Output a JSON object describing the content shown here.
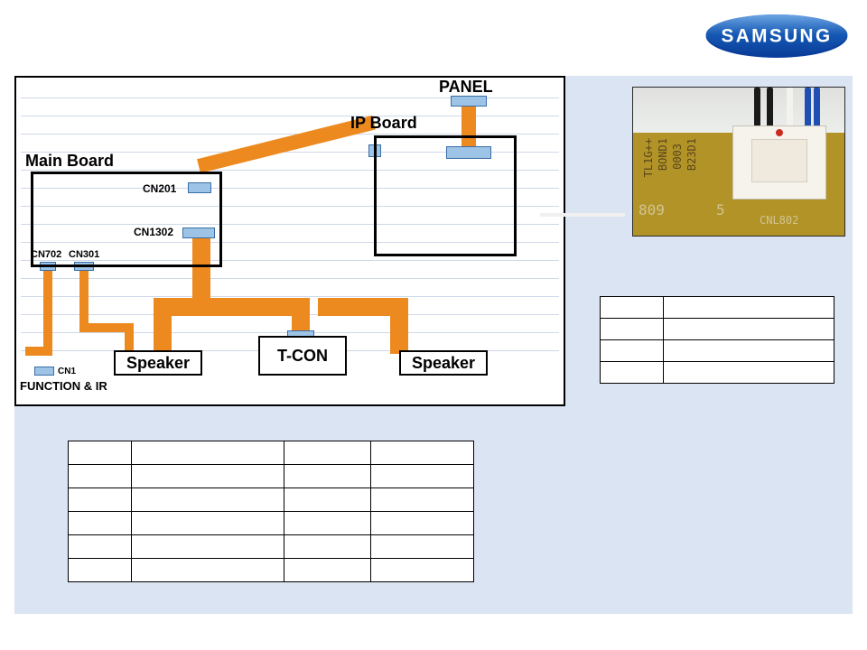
{
  "brand": "SAMSUNG",
  "diagram": {
    "labels": {
      "panel": "PANEL",
      "ip_board": "IP Board",
      "main_board": "Main Board",
      "cn201": "CN201",
      "cn1302": "CN1302",
      "cn702": "CN702",
      "cn301": "CN301",
      "cn1": "CN1",
      "tcon": "T-CON",
      "speaker": "Speaker",
      "function_ir": "FUNCTION & IR"
    }
  },
  "connector_photo": {
    "silk_line1": "TL1G++",
    "silk_line2": "BOND1",
    "silk_line3": "0003",
    "silk_line4": "B23D1",
    "board_num_left": "809",
    "board_num_5": "5",
    "cnl_label": "CNL802"
  },
  "small_table": {
    "rows": [
      [
        "",
        ""
      ],
      [
        "",
        ""
      ],
      [
        "",
        ""
      ],
      [
        "",
        ""
      ]
    ]
  },
  "big_table": {
    "rows": [
      [
        "",
        "",
        "",
        ""
      ],
      [
        "",
        "",
        "",
        ""
      ],
      [
        "",
        "",
        "",
        ""
      ],
      [
        "",
        "",
        "",
        ""
      ],
      [
        "",
        "",
        "",
        ""
      ],
      [
        "",
        "",
        "",
        ""
      ]
    ]
  }
}
